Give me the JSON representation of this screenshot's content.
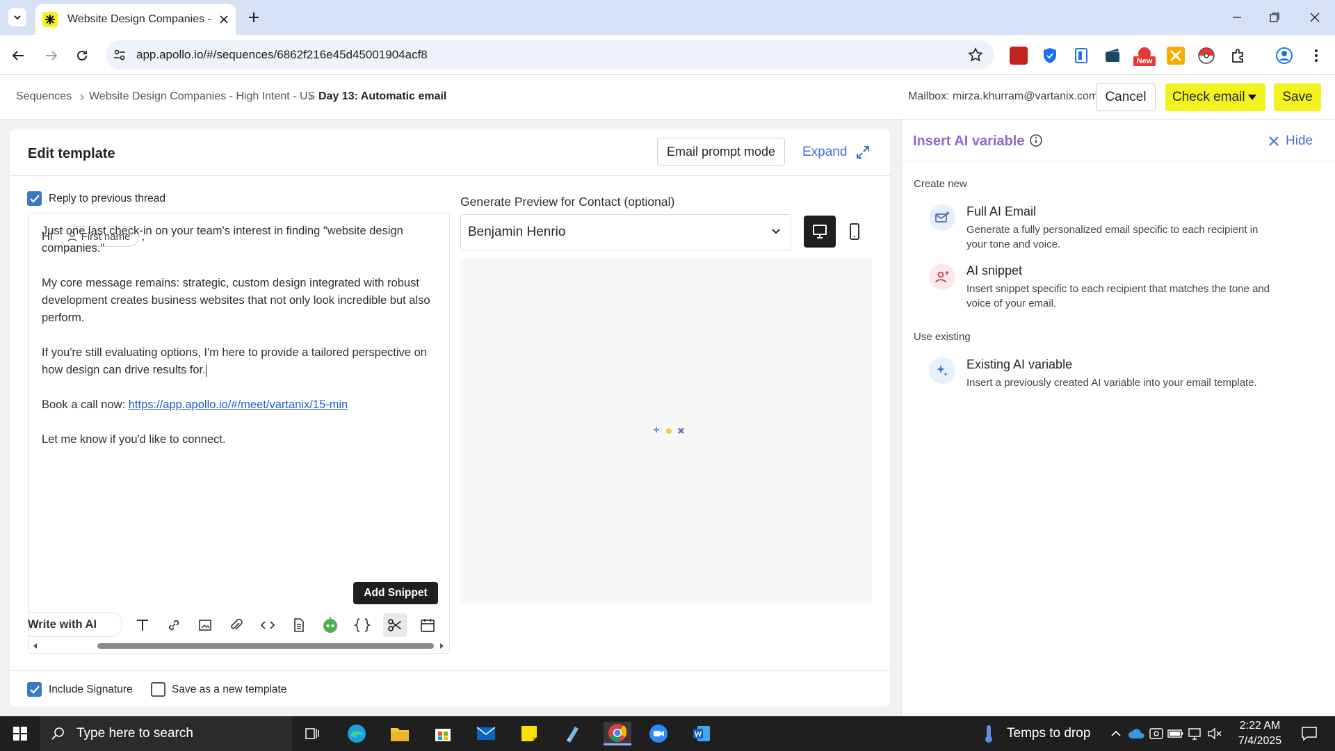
{
  "browser": {
    "tab_title": "Website Design Companies - Hi",
    "url": "app.apollo.io/#/sequences/6862f216e45d45001904acf8",
    "new_badge": "New"
  },
  "header": {
    "breadcrumb": [
      "Sequences",
      "Website Design Companies - High Intent - US",
      "Day 13: Automatic email"
    ],
    "mailbox": "Mailbox: mirza.khurram@vartanix.com",
    "cancel_label": "Cancel",
    "check_email_label": "Check email",
    "save_label": "Save",
    "accent": "#f4f21e"
  },
  "editor": {
    "title": "Edit template",
    "prompt_mode_label": "Email prompt mode",
    "expand_label": "Expand",
    "reply_label": "Reply to previous thread",
    "greeting": "Hi",
    "first_name_chip": "First name",
    "greeting_comma": ",",
    "paragraphs": [
      "Just one last check-in on your team's interest in finding \"website design companies.\"",
      "My core message remains: strategic, custom design integrated with robust development creates business websites that not only look incredible but also perform.",
      "If you're still evaluating options, I'm here to provide a tailored perspective on how design can drive results for."
    ],
    "book_prefix": "Book a call now: ",
    "book_link": "https://app.apollo.io/#/meet/vartanix/15-min",
    "closing": "Let me know if you'd like to connect.",
    "add_snippet_label": "Add Snippet",
    "write_ai_label": "Write with AI",
    "include_signature_label": "Include Signature",
    "save_template_label": "Save as a new template"
  },
  "preview": {
    "label": "Generate Preview for Contact (optional)",
    "contact": "Benjamin Henrio"
  },
  "ai_panel": {
    "title": "Insert AI variable",
    "hide_label": "Hide",
    "create_new_label": "Create new",
    "use_existing_label": "Use existing",
    "options": [
      {
        "title": "Full AI Email",
        "desc": "Generate a fully personalized email specific to each recipient in your tone and voice.",
        "icon": "mail-sparkle-icon"
      },
      {
        "title": "AI snippet",
        "desc": "Insert snippet specific to each recipient that matches the tone and voice of your email.",
        "icon": "person-sparkle-icon"
      },
      {
        "title": "Existing AI variable",
        "desc": "Insert a previously created AI variable into your email template.",
        "icon": "sparkle-icon"
      }
    ]
  },
  "taskbar": {
    "search_placeholder": "Type here to search",
    "weather": "Temps to drop",
    "time": "2:22 AM",
    "date": "7/4/2025"
  }
}
